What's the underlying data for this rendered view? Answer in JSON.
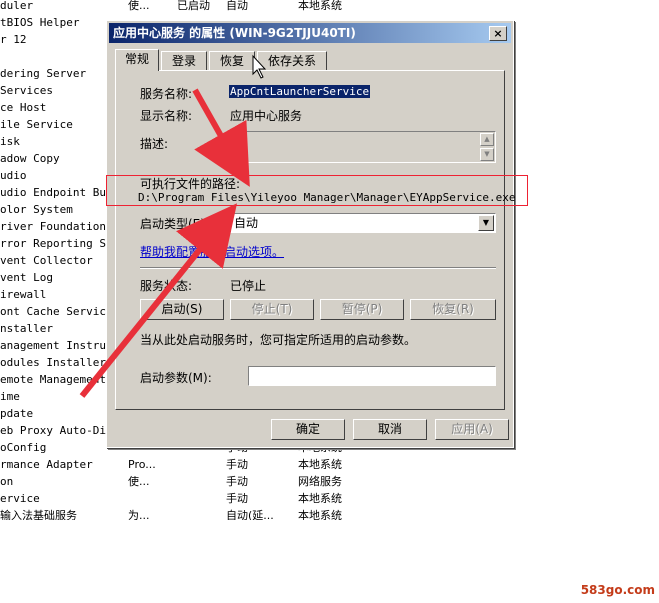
{
  "services_bg": [
    {
      "name": "duler",
      "desc": "使...",
      "status": "已启动",
      "start": "自动",
      "logon": "本地系统"
    },
    {
      "name": "tBIOS Helper",
      "desc": "",
      "status": "",
      "start": "",
      "logon": ""
    },
    {
      "name": "r 12",
      "desc": "",
      "status": "",
      "start": "",
      "logon": ""
    },
    {
      "name": "",
      "desc": "",
      "status": "",
      "start": "",
      "logon": ""
    },
    {
      "name": "dering Server",
      "desc": "",
      "status": "",
      "start": "",
      "logon": ""
    },
    {
      "name": "Services",
      "desc": "",
      "status": "",
      "start": "",
      "logon": ""
    },
    {
      "name": "ce Host",
      "desc": "",
      "status": "",
      "start": "",
      "logon": ""
    },
    {
      "name": "ile Service",
      "desc": "",
      "status": "",
      "start": "",
      "logon": ""
    },
    {
      "name": "isk",
      "desc": "",
      "status": "",
      "start": "",
      "logon": ""
    },
    {
      "name": "adow Copy",
      "desc": "",
      "status": "",
      "start": "",
      "logon": ""
    },
    {
      "name": "udio",
      "desc": "",
      "status": "",
      "start": "",
      "logon": ""
    },
    {
      "name": "udio Endpoint Bu...",
      "desc": "",
      "status": "",
      "start": "",
      "logon": ""
    },
    {
      "name": "olor System",
      "desc": "",
      "status": "",
      "start": "",
      "logon": ""
    },
    {
      "name": "river Foundation...",
      "desc": "",
      "status": "",
      "start": "",
      "logon": ""
    },
    {
      "name": "rror Reporting S...",
      "desc": "",
      "status": "",
      "start": "",
      "logon": ""
    },
    {
      "name": "vent Collector",
      "desc": "",
      "status": "",
      "start": "",
      "logon": ""
    },
    {
      "name": "vent Log",
      "desc": "",
      "status": "",
      "start": "",
      "logon": ""
    },
    {
      "name": "irewall",
      "desc": "",
      "status": "",
      "start": "",
      "logon": ""
    },
    {
      "name": "ont Cache Service",
      "desc": "",
      "status": "",
      "start": "",
      "logon": ""
    },
    {
      "name": "nstaller",
      "desc": "",
      "status": "",
      "start": "",
      "logon": ""
    },
    {
      "name": "anagement Instru...",
      "desc": "",
      "status": "",
      "start": "",
      "logon": ""
    },
    {
      "name": "odules Installer",
      "desc": "",
      "status": "",
      "start": "",
      "logon": ""
    },
    {
      "name": "emote Management...",
      "desc": "",
      "status": "",
      "start": "",
      "logon": ""
    },
    {
      "name": "ime",
      "desc": "",
      "status": "",
      "start": "",
      "logon": ""
    },
    {
      "name": "pdate",
      "desc": "",
      "status": "",
      "start": "",
      "logon": ""
    },
    {
      "name": "eb Proxy Auto-Di...",
      "desc": "",
      "status": "",
      "start": "",
      "logon": ""
    },
    {
      "name": "oConfig",
      "desc": "",
      "status": "",
      "start": "手动",
      "logon": "本地系统"
    },
    {
      "name": "rmance Adapter",
      "desc": "Pro...",
      "status": "",
      "start": "手动",
      "logon": "本地系统"
    },
    {
      "name": "on",
      "desc": "使...",
      "status": "",
      "start": "手动",
      "logon": "网络服务"
    },
    {
      "name": "ervice",
      "desc": "",
      "status": "",
      "start": "手动",
      "logon": "本地系统"
    },
    {
      "name": "输入法基础服务",
      "desc": "为...",
      "status": "",
      "start": "自动(延...",
      "logon": "本地系统"
    }
  ],
  "watermark": "583go.com",
  "dialog": {
    "title": "应用中心服务 的属性 (WIN-9G2TJJU40TI)",
    "close": "×",
    "tabs": [
      "常规",
      "登录",
      "恢复",
      "依存关系"
    ],
    "service_name_label": "服务名称:",
    "service_name_value": "AppCntLauncherService",
    "display_name_label": "显示名称:",
    "display_name_value": "应用中心服务",
    "description_label": "描述:",
    "exe_path_label": "可执行文件的路径:",
    "exe_path_value": "D:\\Program Files\\Yileyoo Manager\\Manager\\EYAppService.exe",
    "startup_type_label": "启动类型(E):",
    "startup_type_value": "自动",
    "help_link": "帮助我配置服务启动选项。",
    "service_status_label": "服务状态:",
    "service_status_value": "已停止",
    "btn_start": "启动(S)",
    "btn_stop": "停止(T)",
    "btn_pause": "暂停(P)",
    "btn_resume": "恢复(R)",
    "hint": "当从此处启动服务时，您可指定所适用的启动参数。",
    "start_params_label": "启动参数(M):",
    "start_params_value": "",
    "btn_ok": "确定",
    "btn_cancel": "取消",
    "btn_apply": "应用(A)"
  },
  "colors": {
    "titlebar": "#0a246a",
    "annotation": "#e8303a",
    "face": "#d4d0c8"
  }
}
